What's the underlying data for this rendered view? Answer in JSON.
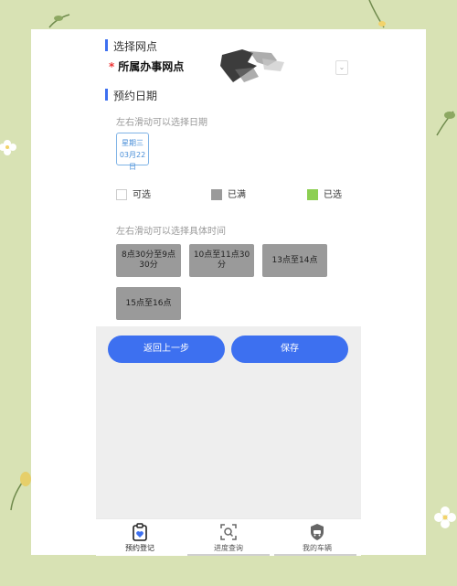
{
  "sections": {
    "branch_title": "选择网点",
    "date_title": "预约日期"
  },
  "office": {
    "label": "所属办事网点",
    "required_mark": "*"
  },
  "date_picker": {
    "hint": "左右滑动可以选择日期",
    "selected_date": {
      "weekday": "星期三",
      "date": "03月22日"
    }
  },
  "legend": {
    "available": "可选",
    "full": "已满",
    "selected": "已选"
  },
  "time_picker": {
    "hint": "左右滑动可以选择具体时间",
    "slots": [
      "8点30分至9点30分",
      "10点至11点30分",
      "13点至14点",
      "15点至16点"
    ]
  },
  "actions": {
    "back": "返回上一步",
    "save": "保存"
  },
  "tabbar": {
    "tabs": [
      "预约登记",
      "进度查询",
      "我的车辆"
    ]
  },
  "colors": {
    "accent": "#3d70f0",
    "full": "#9a9a9a",
    "selected": "#8ccf52",
    "background": "#d8e2b4"
  }
}
